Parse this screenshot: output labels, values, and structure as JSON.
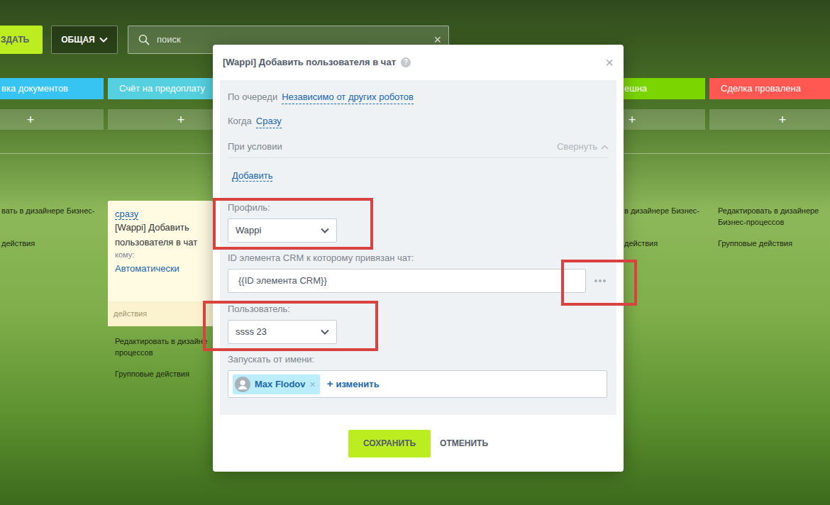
{
  "toolbar": {
    "create": "ЗДАТЬ",
    "filter": "ОБЩАЯ",
    "search": {
      "placeholder": "поиск",
      "clear": "×"
    }
  },
  "columns": [
    {
      "stage": "вка документов",
      "color": "#38c4f2",
      "add": "+",
      "robots": [],
      "links": [
        "вать в дизайнере Бизнес-"
      ],
      "group": "действия"
    },
    {
      "stage": "Счёт на предоплату",
      "color": "#55d0e0",
      "add": "+",
      "robots": [
        {
          "when": "сразу",
          "title": "[Wappi] Добавить пользователя в чат",
          "to_label": "кому:",
          "to": "Автоматически",
          "footer": "действия"
        }
      ],
      "links": [
        "Редактировать в дизайне",
        "процессов"
      ],
      "group": "Групповые действия"
    },
    {
      "stage": "ешна",
      "color": "#7bd500",
      "add": "+",
      "robots": [],
      "links": [
        "в дизайнере Бизнес-"
      ],
      "group": "действия"
    },
    {
      "stage": "Сделка провалена",
      "color": "#ff5752",
      "add": "+",
      "robots": [],
      "links": [
        "Редактировать в дизайнере Бизнес-процессов"
      ],
      "group": "Групповые действия"
    }
  ],
  "dialog": {
    "title": "[Wappi] Добавить пользователя в чат",
    "help": "?",
    "close": "×",
    "order": {
      "label": "По очереди",
      "value": "Независимо от других роботов"
    },
    "when": {
      "label": "Когда",
      "value": "Сразу"
    },
    "condition": {
      "label": "При условии",
      "toggle": "Свернуть",
      "add": "Добавить"
    },
    "fields": [
      {
        "kind": "select",
        "label": "Профиль:",
        "value": "Wappi"
      },
      {
        "kind": "input",
        "label": "ID элемента CRM к которому привязан чат:",
        "value": "{{ID элемента CRM}}"
      },
      {
        "kind": "select",
        "label": "Пользователь:",
        "value": "ssss 23"
      },
      {
        "kind": "user",
        "label": "Запускать от имени:",
        "users": [
          {
            "name": "Max Flodov",
            "remove": "×"
          }
        ],
        "add": "+",
        "change": "изменить"
      }
    ],
    "buttons": [
      {
        "label": "СОХРАНИТЬ",
        "primary": true
      },
      {
        "label": "ОТМЕНИТЬ",
        "primary": false
      }
    ]
  }
}
